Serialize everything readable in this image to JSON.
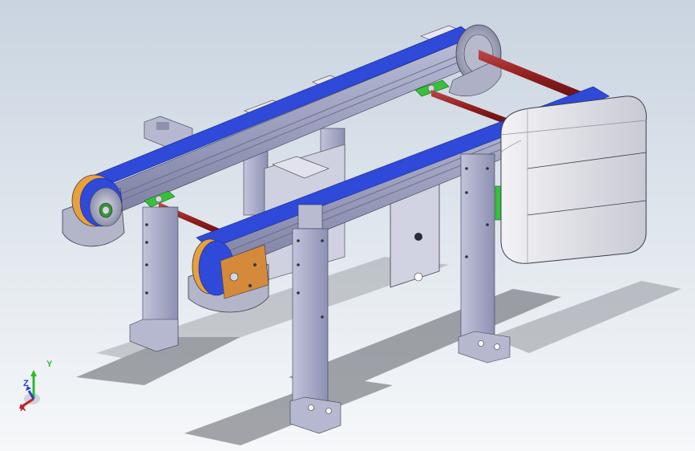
{
  "viewport": {
    "background_top": "#c9d4e0",
    "background_bottom": "#f6f8fa"
  },
  "model": {
    "belt_color": "#2f49d8",
    "frame_color": "#a6a9c8",
    "shaft_color": "#8e1d1d",
    "bearing_color": "#35c23a",
    "pulley_accent": "#e8a13a",
    "cover_color": "#e6e7ec"
  },
  "triad": {
    "x_label": "X",
    "y_label": "Y",
    "z_label": "Z",
    "x_color": "#c41e1e",
    "y_color": "#2dbb2d",
    "z_color": "#2c3ec9"
  }
}
